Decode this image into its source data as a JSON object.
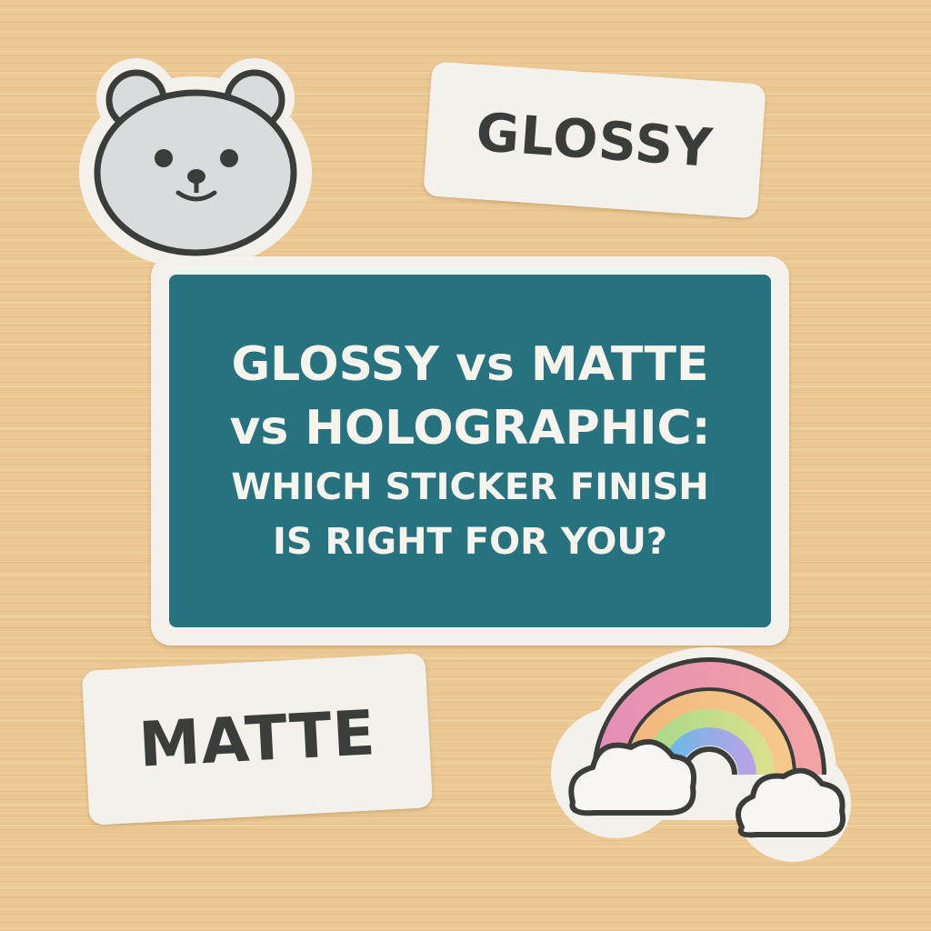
{
  "stickers": {
    "glossy_label": "GLOSSY",
    "matte_label": "MATTE",
    "title_lines": [
      "GLOSSY vs MATTE",
      "vs HOLOGRAPHIC:"
    ],
    "subtitle_lines": [
      "WHICH STICKER FINISH",
      "IS RIGHT FOR YOU?"
    ],
    "bear_icon": "bear-face-icon",
    "rainbow_icon": "rainbow-clouds-icon"
  },
  "colors": {
    "background_wood": "#ecc994",
    "sticker_white": "#f4f1ec",
    "title_panel_teal": "#27727f",
    "outline_dark": "#3b3d3a",
    "bear_face_gray": "#d9dbdc"
  }
}
